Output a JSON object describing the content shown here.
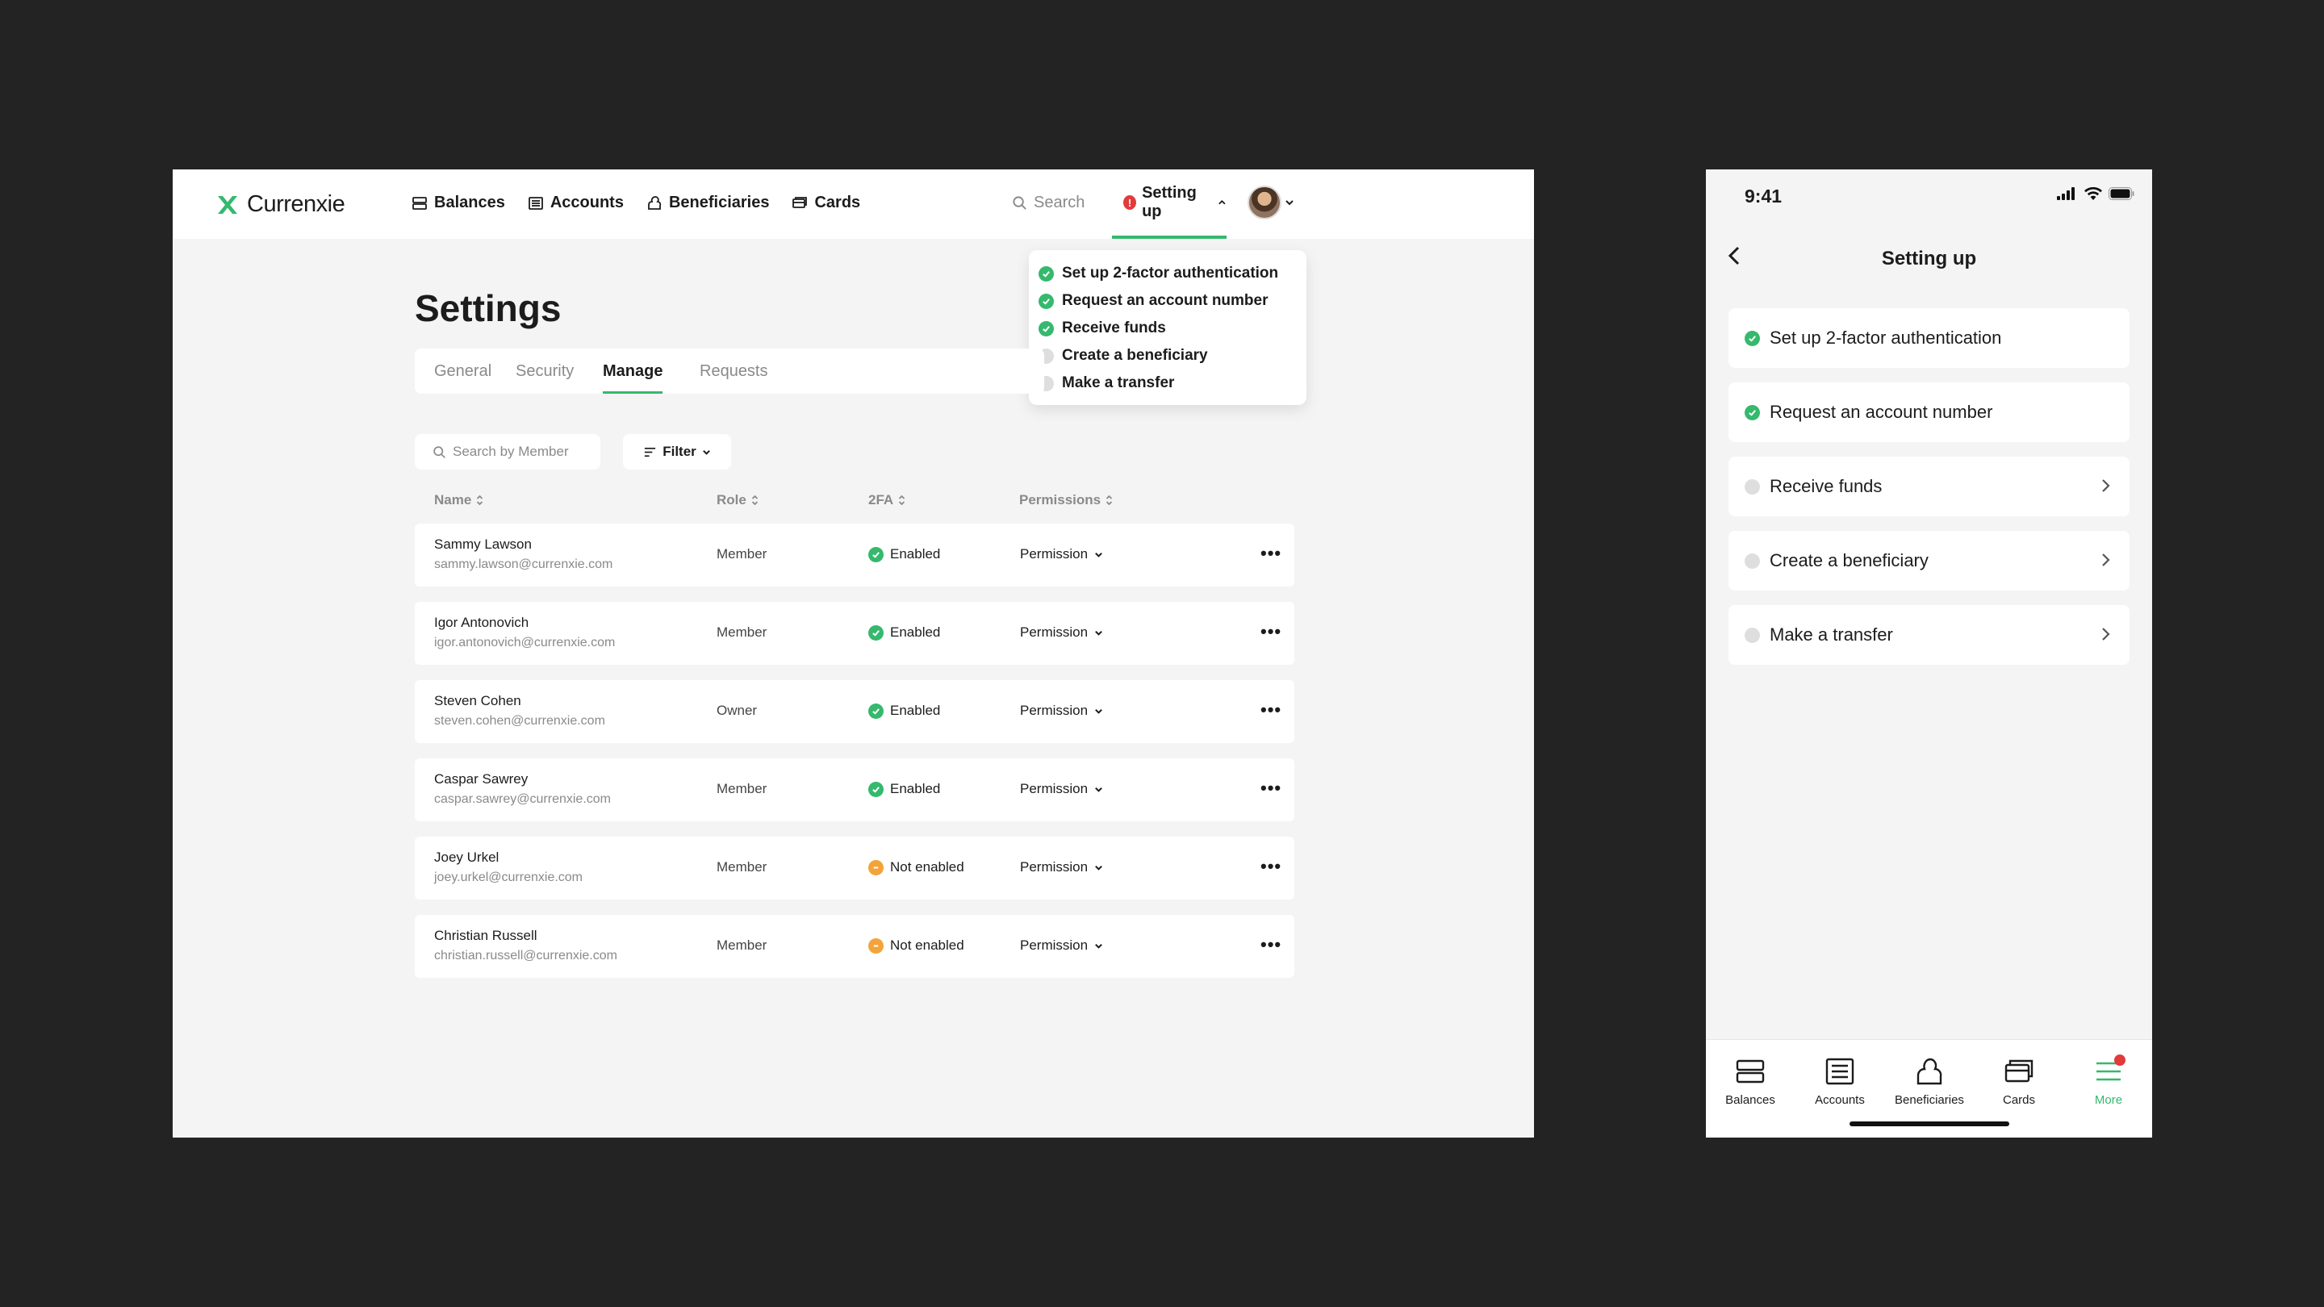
{
  "desktop": {
    "brand": "Currenxie",
    "nav": [
      {
        "label": "Balances",
        "icon": "balances-icon"
      },
      {
        "label": "Accounts",
        "icon": "accounts-icon"
      },
      {
        "label": "Beneficiaries",
        "icon": "beneficiaries-icon"
      },
      {
        "label": "Cards",
        "icon": "cards-icon"
      }
    ],
    "search_label": "Search",
    "setup_label": "Setting up",
    "setup_menu": [
      {
        "label": "Set up 2-factor authentication",
        "done": true
      },
      {
        "label": "Request an account number",
        "done": true
      },
      {
        "label": "Receive funds",
        "done": true
      },
      {
        "label": "Create a beneficiary",
        "done": false
      },
      {
        "label": "Make a transfer",
        "done": false
      }
    ],
    "page_title": "Settings",
    "tabs": [
      "General",
      "Security",
      "Manage",
      "Requests"
    ],
    "active_tab": "Manage",
    "member_search_placeholder": "Search by Member",
    "filter_label": "Filter",
    "columns": [
      "Name",
      "Role",
      "2FA",
      "Permissions"
    ],
    "members": [
      {
        "name": "Sammy Lawson",
        "email": "sammy.lawson@currenxie.com",
        "role": "Member",
        "twofa": "Enabled",
        "permission": "Permission",
        "more": "•••"
      },
      {
        "name": "Igor Antonovich",
        "email": "igor.antonovich@currenxie.com",
        "role": "Member",
        "twofa": "Enabled",
        "permission": "Permission",
        "more": "•••"
      },
      {
        "name": "Steven Cohen",
        "email": "steven.cohen@currenxie.com",
        "role": "Owner",
        "twofa": "Enabled",
        "permission": "Permission",
        "more": "•••"
      },
      {
        "name": "Caspar Sawrey",
        "email": "caspar.sawrey@currenxie.com",
        "role": "Member",
        "twofa": "Enabled",
        "permission": "Permission",
        "more": "•••"
      },
      {
        "name": "Joey Urkel",
        "email": "joey.urkel@currenxie.com",
        "role": "Member",
        "twofa": "Not enabled",
        "permission": "Permission",
        "more": "•••"
      },
      {
        "name": "Christian Russell",
        "email": "christian.russell@currenxie.com",
        "role": "Member",
        "twofa": "Not enabled",
        "permission": "Permission",
        "more": "•••"
      }
    ]
  },
  "mobile": {
    "time": "9:41",
    "back_glyph": "‹",
    "title": "Setting up",
    "steps": [
      {
        "label": "Set up 2-factor authentication",
        "done": true,
        "chevron": false
      },
      {
        "label": "Request an account number",
        "done": true,
        "chevron": false
      },
      {
        "label": "Receive funds",
        "done": false,
        "chevron": true
      },
      {
        "label": "Create a beneficiary",
        "done": false,
        "chevron": true
      },
      {
        "label": "Make a transfer",
        "done": false,
        "chevron": true
      }
    ],
    "tabbar": [
      {
        "label": "Balances",
        "icon": "balances-icon"
      },
      {
        "label": "Accounts",
        "icon": "accounts-icon"
      },
      {
        "label": "Beneficiaries",
        "icon": "beneficiaries-icon"
      },
      {
        "label": "Cards",
        "icon": "cards-icon"
      },
      {
        "label": "More",
        "icon": "menu-icon",
        "active": true
      }
    ]
  },
  "colors": {
    "accent": "#35b96d",
    "alert": "#e23b3b",
    "warning": "#f2a43a",
    "backdrop": "#232323"
  }
}
